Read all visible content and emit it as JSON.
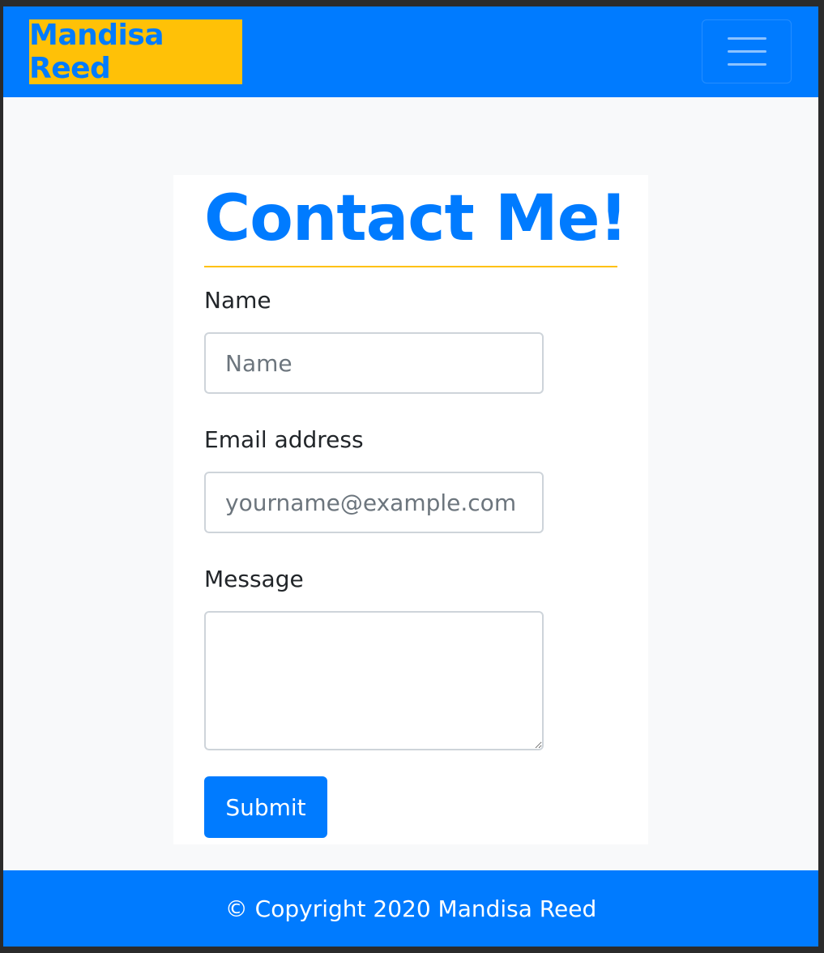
{
  "navbar": {
    "brand": "Mandisa Reed",
    "toggle_icon": "hamburger-menu-icon",
    "colors": {
      "background": "#007bff",
      "brand_background": "#ffc107",
      "brand_text": "#007bff"
    }
  },
  "contact": {
    "title": "Contact Me!",
    "name_label": "Name",
    "name_placeholder": "Name",
    "name_value": "",
    "email_label": "Email address",
    "email_placeholder": "yourname@example.com",
    "email_value": "",
    "message_label": "Message",
    "message_value": "",
    "submit_label": "Submit"
  },
  "footer": {
    "text": "© Copyright 2020 Mandisa Reed"
  }
}
